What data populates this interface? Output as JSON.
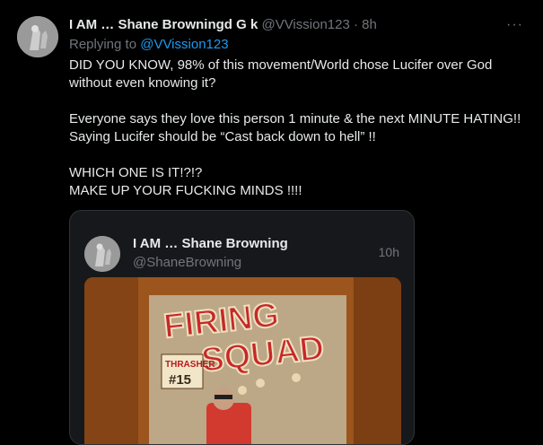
{
  "tweet": {
    "author_name": "I AM … Shane Browningd G k",
    "author_handle": "@VVission123",
    "separator": "·",
    "time": "8h",
    "more_icon": "more-icon",
    "replying_prefix": "Replying to",
    "replying_to": "@VVission123",
    "text_lines": [
      "DID YOU KNOW, 98% of this movement/World chose Lucifer over God without even knowing it?",
      "Everyone says they love this person 1 minute & the next MINUTE HATING!! Saying Lucifer should be “Cast back down to hell” !!",
      "WHICH ONE IS IT!?!?",
      "MAKE UP YOUR FUCKING MINDS !!!!"
    ]
  },
  "quote": {
    "author_name": "I AM … Shane Browning",
    "author_handle": "@ShaneBrowning",
    "time": "10h",
    "media_text": {
      "line1": "FIRING",
      "line2": "SQUAD",
      "badge": "#15",
      "brand": "THRASHER"
    }
  },
  "colors": {
    "background": "#000000",
    "text": "#e7e9ea",
    "muted": "#71767b",
    "link": "#1d9bf0",
    "card_border": "#2f3336"
  }
}
